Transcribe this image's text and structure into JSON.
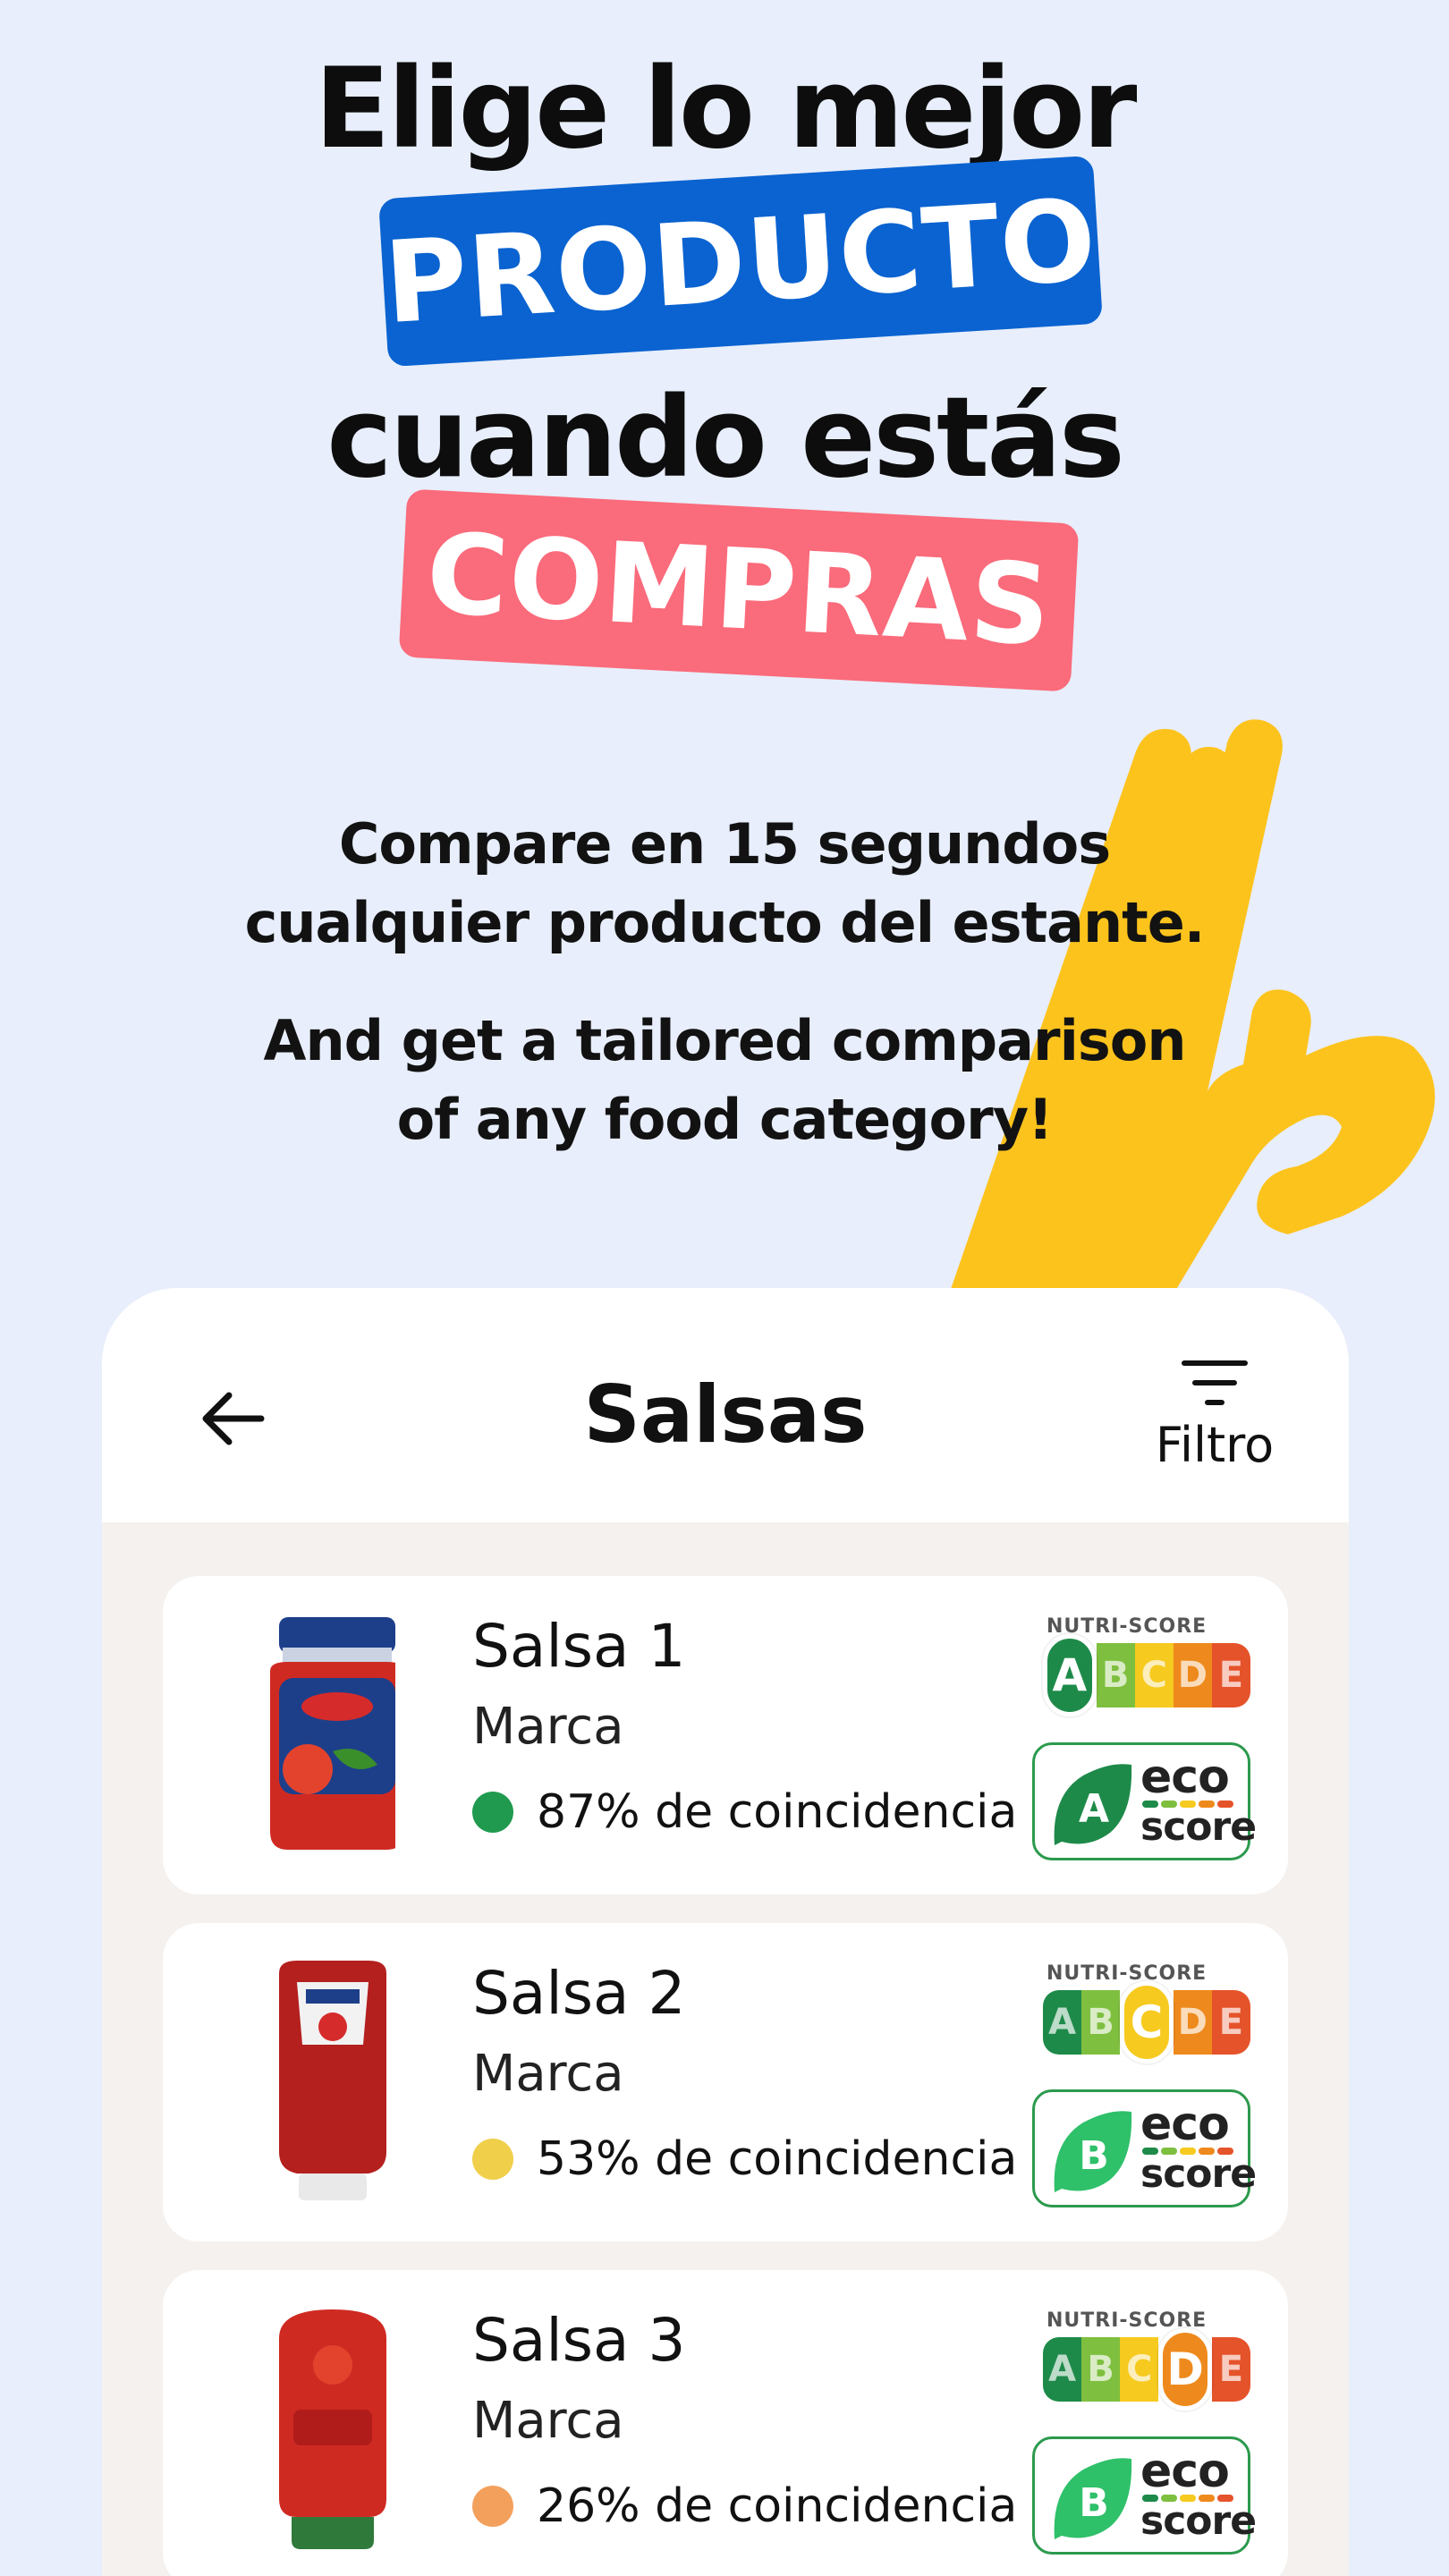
{
  "hero": {
    "line1": "Elige lo mejor",
    "highlight1": "PRODUCTO",
    "line2": "cuando estás",
    "highlight2": "COMPRAS"
  },
  "tagline": {
    "line1": "Compare en 15 segundos",
    "line2": "cualquier producto del estante.",
    "line3": "And get a tailored comparison",
    "line4": "of any food category!"
  },
  "header": {
    "title": "Salsas",
    "filter_label": "Filtro",
    "back_icon": "arrow-left-icon",
    "filter_icon": "filter-icon"
  },
  "products": [
    {
      "name": "Salsa 1",
      "brand": "Marca",
      "match": "87% de coincidencia",
      "match_color": "#1f9a4f",
      "nutri_label": "NUTRI-SCORE",
      "nutri_grade": "A",
      "eco_grade": "A",
      "eco_word1": "eco",
      "eco_word2": "score",
      "image": "sauce-jar"
    },
    {
      "name": "Salsa 2",
      "brand": "Marca",
      "match": "53% de coincidencia",
      "match_color": "#f0cf4a",
      "nutri_label": "NUTRI-SCORE",
      "nutri_grade": "C",
      "eco_grade": "B",
      "eco_word1": "eco",
      "eco_word2": "score",
      "image": "ketchup-bottle"
    },
    {
      "name": "Salsa 3",
      "brand": "Marca",
      "match": "26% de coincidencia",
      "match_color": "#f3a05c",
      "nutri_label": "NUTRI-SCORE",
      "nutri_grade": "D",
      "eco_grade": "B",
      "eco_word1": "eco",
      "eco_word2": "score",
      "image": "ketchup-bottle-red"
    }
  ],
  "nutri_letters": [
    "A",
    "B",
    "C",
    "D",
    "E"
  ],
  "colors": {
    "background": "#e8eefb",
    "pill_blue": "#0a63d0",
    "pill_pink": "#fa6b7b",
    "hand_yellow": "#fdc31d",
    "nutri": [
      "#1e8a4a",
      "#7fbf3f",
      "#f6ca1f",
      "#ee8a1d",
      "#e5532a"
    ],
    "eco_a": "#1e8a4a",
    "eco_b": "#2fc06a"
  }
}
